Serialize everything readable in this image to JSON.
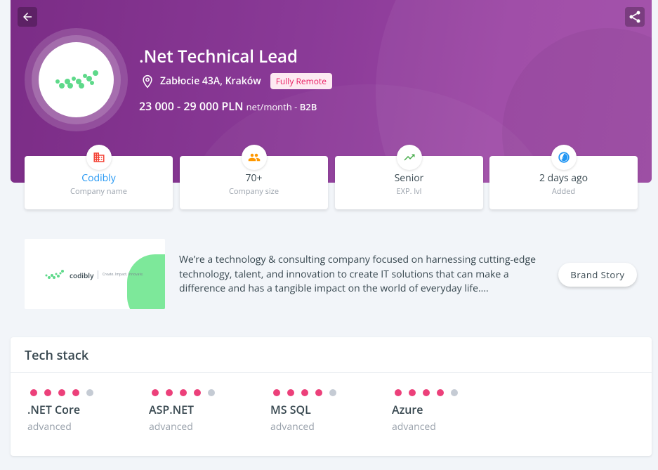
{
  "job": {
    "title": ".Net Technical Lead",
    "location": "Zabłocie 43A, Kraków",
    "remote_badge": "Fully Remote",
    "salary_amount": "23 000 - 29 000 PLN",
    "salary_period": "net/month - ",
    "contract": "B2B"
  },
  "info_cards": [
    {
      "value": "Codibly",
      "label": "Company name",
      "icon": "building-icon",
      "color": "#f44336"
    },
    {
      "value": "70+",
      "label": "Company size",
      "icon": "people-icon",
      "color": "#ff9800"
    },
    {
      "value": "Senior",
      "label": "EXP. lvl",
      "icon": "trending-up-icon",
      "color": "#4caf50"
    },
    {
      "value": "2 days ago",
      "label": "Added",
      "icon": "clock-icon",
      "color": "#2196f3"
    }
  ],
  "brand": {
    "logo_name": "codibly",
    "logo_tagline": "Create. Impact. Innovate.",
    "description": "We’re a technology & consulting company focused on harnessing cutting-edge technology, talent, and innovation to create IT solutions that can make a difference and has a tangible impact on the world of everyday life....",
    "button_label": "Brand Story"
  },
  "tech_stack": {
    "title": "Tech stack",
    "items": [
      {
        "name": ".NET Core",
        "level": "advanced",
        "rating": 4,
        "max": 5
      },
      {
        "name": "ASP.NET",
        "level": "advanced",
        "rating": 4,
        "max": 5
      },
      {
        "name": "MS SQL",
        "level": "advanced",
        "rating": 4,
        "max": 5
      },
      {
        "name": "Azure",
        "level": "advanced",
        "rating": 4,
        "max": 5
      }
    ]
  },
  "colors": {
    "hero": "#8a3a97",
    "accent_pink": "#e91e63",
    "logo_green": "#5ed98a"
  }
}
